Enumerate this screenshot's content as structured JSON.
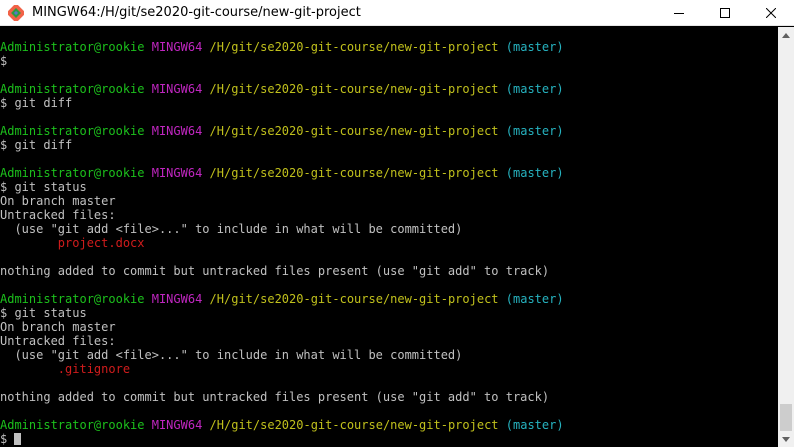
{
  "window": {
    "title": "MINGW64:/H/git/se2020-git-course/new-git-project",
    "app_icon": "git-bash-icon",
    "controls": [
      "minimize-icon",
      "maximize-icon",
      "close-icon"
    ]
  },
  "colors": {
    "background": "#000000",
    "user_host": "#1cc01c",
    "mingw": "#c026c0",
    "path": "#c0c01c",
    "branch": "#26b3c0",
    "text": "#c0c0c0",
    "untracked_file": "#d01c1c"
  },
  "terminal": {
    "lines": [
      [
        {
          "t": "Administrator@rookie",
          "c": "green"
        },
        {
          "t": " ",
          "c": "gray"
        },
        {
          "t": "MINGW64",
          "c": "magenta"
        },
        {
          "t": " ",
          "c": "gray"
        },
        {
          "t": "/H/git/se2020-git-course/new-git-project",
          "c": "yellow"
        },
        {
          "t": " ",
          "c": "gray"
        },
        {
          "t": "(master)",
          "c": "cyan"
        }
      ],
      [
        {
          "t": "$",
          "c": "gray"
        }
      ],
      [],
      [
        {
          "t": "Administrator@rookie",
          "c": "green"
        },
        {
          "t": " ",
          "c": "gray"
        },
        {
          "t": "MINGW64",
          "c": "magenta"
        },
        {
          "t": " ",
          "c": "gray"
        },
        {
          "t": "/H/git/se2020-git-course/new-git-project",
          "c": "yellow"
        },
        {
          "t": " ",
          "c": "gray"
        },
        {
          "t": "(master)",
          "c": "cyan"
        }
      ],
      [
        {
          "t": "$ git diff",
          "c": "gray"
        }
      ],
      [],
      [
        {
          "t": "Administrator@rookie",
          "c": "green"
        },
        {
          "t": " ",
          "c": "gray"
        },
        {
          "t": "MINGW64",
          "c": "magenta"
        },
        {
          "t": " ",
          "c": "gray"
        },
        {
          "t": "/H/git/se2020-git-course/new-git-project",
          "c": "yellow"
        },
        {
          "t": " ",
          "c": "gray"
        },
        {
          "t": "(master)",
          "c": "cyan"
        }
      ],
      [
        {
          "t": "$ git diff",
          "c": "gray"
        }
      ],
      [],
      [
        {
          "t": "Administrator@rookie",
          "c": "green"
        },
        {
          "t": " ",
          "c": "gray"
        },
        {
          "t": "MINGW64",
          "c": "magenta"
        },
        {
          "t": " ",
          "c": "gray"
        },
        {
          "t": "/H/git/se2020-git-course/new-git-project",
          "c": "yellow"
        },
        {
          "t": " ",
          "c": "gray"
        },
        {
          "t": "(master)",
          "c": "cyan"
        }
      ],
      [
        {
          "t": "$ git status",
          "c": "gray"
        }
      ],
      [
        {
          "t": "On branch master",
          "c": "gray"
        }
      ],
      [
        {
          "t": "Untracked files:",
          "c": "gray"
        }
      ],
      [
        {
          "t": "  (use \"git add <file>...\" to include in what will be committed)",
          "c": "gray"
        }
      ],
      [
        {
          "t": "        ",
          "c": "gray"
        },
        {
          "t": "project.docx",
          "c": "red"
        }
      ],
      [],
      [
        {
          "t": "nothing added to commit but untracked files present (use \"git add\" to track)",
          "c": "gray"
        }
      ],
      [],
      [
        {
          "t": "Administrator@rookie",
          "c": "green"
        },
        {
          "t": " ",
          "c": "gray"
        },
        {
          "t": "MINGW64",
          "c": "magenta"
        },
        {
          "t": " ",
          "c": "gray"
        },
        {
          "t": "/H/git/se2020-git-course/new-git-project",
          "c": "yellow"
        },
        {
          "t": " ",
          "c": "gray"
        },
        {
          "t": "(master)",
          "c": "cyan"
        }
      ],
      [
        {
          "t": "$ git status",
          "c": "gray"
        }
      ],
      [
        {
          "t": "On branch master",
          "c": "gray"
        }
      ],
      [
        {
          "t": "Untracked files:",
          "c": "gray"
        }
      ],
      [
        {
          "t": "  (use \"git add <file>...\" to include in what will be committed)",
          "c": "gray"
        }
      ],
      [
        {
          "t": "        ",
          "c": "gray"
        },
        {
          "t": ".gitignore",
          "c": "red"
        }
      ],
      [],
      [
        {
          "t": "nothing added to commit but untracked files present (use \"git add\" to track)",
          "c": "gray"
        }
      ],
      [],
      [
        {
          "t": "Administrator@rookie",
          "c": "green"
        },
        {
          "t": " ",
          "c": "gray"
        },
        {
          "t": "MINGW64",
          "c": "magenta"
        },
        {
          "t": " ",
          "c": "gray"
        },
        {
          "t": "/H/git/se2020-git-course/new-git-project",
          "c": "yellow"
        },
        {
          "t": " ",
          "c": "gray"
        },
        {
          "t": "(master)",
          "c": "cyan"
        }
      ],
      [
        {
          "t": "$ ",
          "c": "gray"
        }
      ]
    ]
  },
  "scrollbar": {
    "up_icon": "scroll-up-arrow-icon",
    "down_icon": "scroll-down-arrow-icon"
  }
}
